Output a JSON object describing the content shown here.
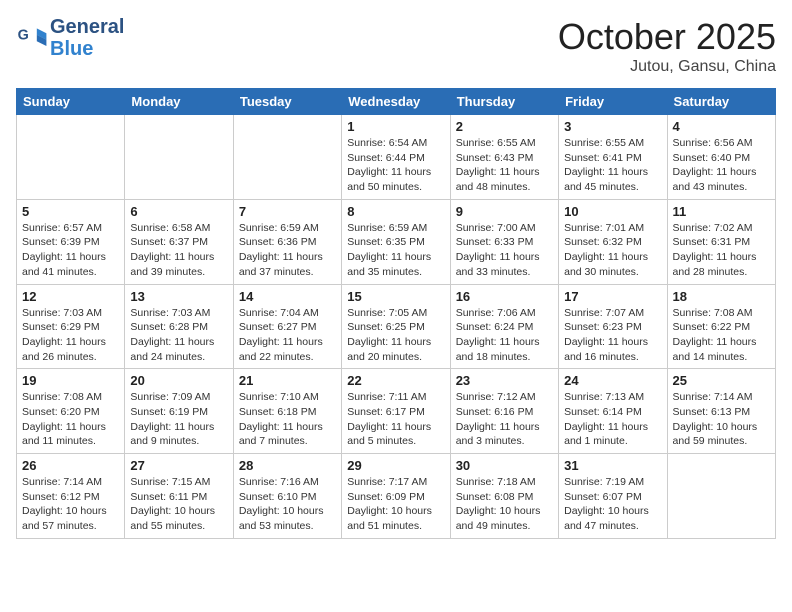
{
  "header": {
    "logo_line1": "General",
    "logo_line2": "Blue",
    "month": "October 2025",
    "location": "Jutou, Gansu, China"
  },
  "days_of_week": [
    "Sunday",
    "Monday",
    "Tuesday",
    "Wednesday",
    "Thursday",
    "Friday",
    "Saturday"
  ],
  "weeks": [
    [
      {
        "day": "",
        "info": ""
      },
      {
        "day": "",
        "info": ""
      },
      {
        "day": "",
        "info": ""
      },
      {
        "day": "1",
        "info": "Sunrise: 6:54 AM\nSunset: 6:44 PM\nDaylight: 11 hours\nand 50 minutes."
      },
      {
        "day": "2",
        "info": "Sunrise: 6:55 AM\nSunset: 6:43 PM\nDaylight: 11 hours\nand 48 minutes."
      },
      {
        "day": "3",
        "info": "Sunrise: 6:55 AM\nSunset: 6:41 PM\nDaylight: 11 hours\nand 45 minutes."
      },
      {
        "day": "4",
        "info": "Sunrise: 6:56 AM\nSunset: 6:40 PM\nDaylight: 11 hours\nand 43 minutes."
      }
    ],
    [
      {
        "day": "5",
        "info": "Sunrise: 6:57 AM\nSunset: 6:39 PM\nDaylight: 11 hours\nand 41 minutes."
      },
      {
        "day": "6",
        "info": "Sunrise: 6:58 AM\nSunset: 6:37 PM\nDaylight: 11 hours\nand 39 minutes."
      },
      {
        "day": "7",
        "info": "Sunrise: 6:59 AM\nSunset: 6:36 PM\nDaylight: 11 hours\nand 37 minutes."
      },
      {
        "day": "8",
        "info": "Sunrise: 6:59 AM\nSunset: 6:35 PM\nDaylight: 11 hours\nand 35 minutes."
      },
      {
        "day": "9",
        "info": "Sunrise: 7:00 AM\nSunset: 6:33 PM\nDaylight: 11 hours\nand 33 minutes."
      },
      {
        "day": "10",
        "info": "Sunrise: 7:01 AM\nSunset: 6:32 PM\nDaylight: 11 hours\nand 30 minutes."
      },
      {
        "day": "11",
        "info": "Sunrise: 7:02 AM\nSunset: 6:31 PM\nDaylight: 11 hours\nand 28 minutes."
      }
    ],
    [
      {
        "day": "12",
        "info": "Sunrise: 7:03 AM\nSunset: 6:29 PM\nDaylight: 11 hours\nand 26 minutes."
      },
      {
        "day": "13",
        "info": "Sunrise: 7:03 AM\nSunset: 6:28 PM\nDaylight: 11 hours\nand 24 minutes."
      },
      {
        "day": "14",
        "info": "Sunrise: 7:04 AM\nSunset: 6:27 PM\nDaylight: 11 hours\nand 22 minutes."
      },
      {
        "day": "15",
        "info": "Sunrise: 7:05 AM\nSunset: 6:25 PM\nDaylight: 11 hours\nand 20 minutes."
      },
      {
        "day": "16",
        "info": "Sunrise: 7:06 AM\nSunset: 6:24 PM\nDaylight: 11 hours\nand 18 minutes."
      },
      {
        "day": "17",
        "info": "Sunrise: 7:07 AM\nSunset: 6:23 PM\nDaylight: 11 hours\nand 16 minutes."
      },
      {
        "day": "18",
        "info": "Sunrise: 7:08 AM\nSunset: 6:22 PM\nDaylight: 11 hours\nand 14 minutes."
      }
    ],
    [
      {
        "day": "19",
        "info": "Sunrise: 7:08 AM\nSunset: 6:20 PM\nDaylight: 11 hours\nand 11 minutes."
      },
      {
        "day": "20",
        "info": "Sunrise: 7:09 AM\nSunset: 6:19 PM\nDaylight: 11 hours\nand 9 minutes."
      },
      {
        "day": "21",
        "info": "Sunrise: 7:10 AM\nSunset: 6:18 PM\nDaylight: 11 hours\nand 7 minutes."
      },
      {
        "day": "22",
        "info": "Sunrise: 7:11 AM\nSunset: 6:17 PM\nDaylight: 11 hours\nand 5 minutes."
      },
      {
        "day": "23",
        "info": "Sunrise: 7:12 AM\nSunset: 6:16 PM\nDaylight: 11 hours\nand 3 minutes."
      },
      {
        "day": "24",
        "info": "Sunrise: 7:13 AM\nSunset: 6:14 PM\nDaylight: 11 hours\nand 1 minute."
      },
      {
        "day": "25",
        "info": "Sunrise: 7:14 AM\nSunset: 6:13 PM\nDaylight: 10 hours\nand 59 minutes."
      }
    ],
    [
      {
        "day": "26",
        "info": "Sunrise: 7:14 AM\nSunset: 6:12 PM\nDaylight: 10 hours\nand 57 minutes."
      },
      {
        "day": "27",
        "info": "Sunrise: 7:15 AM\nSunset: 6:11 PM\nDaylight: 10 hours\nand 55 minutes."
      },
      {
        "day": "28",
        "info": "Sunrise: 7:16 AM\nSunset: 6:10 PM\nDaylight: 10 hours\nand 53 minutes."
      },
      {
        "day": "29",
        "info": "Sunrise: 7:17 AM\nSunset: 6:09 PM\nDaylight: 10 hours\nand 51 minutes."
      },
      {
        "day": "30",
        "info": "Sunrise: 7:18 AM\nSunset: 6:08 PM\nDaylight: 10 hours\nand 49 minutes."
      },
      {
        "day": "31",
        "info": "Sunrise: 7:19 AM\nSunset: 6:07 PM\nDaylight: 10 hours\nand 47 minutes."
      },
      {
        "day": "",
        "info": ""
      }
    ]
  ]
}
